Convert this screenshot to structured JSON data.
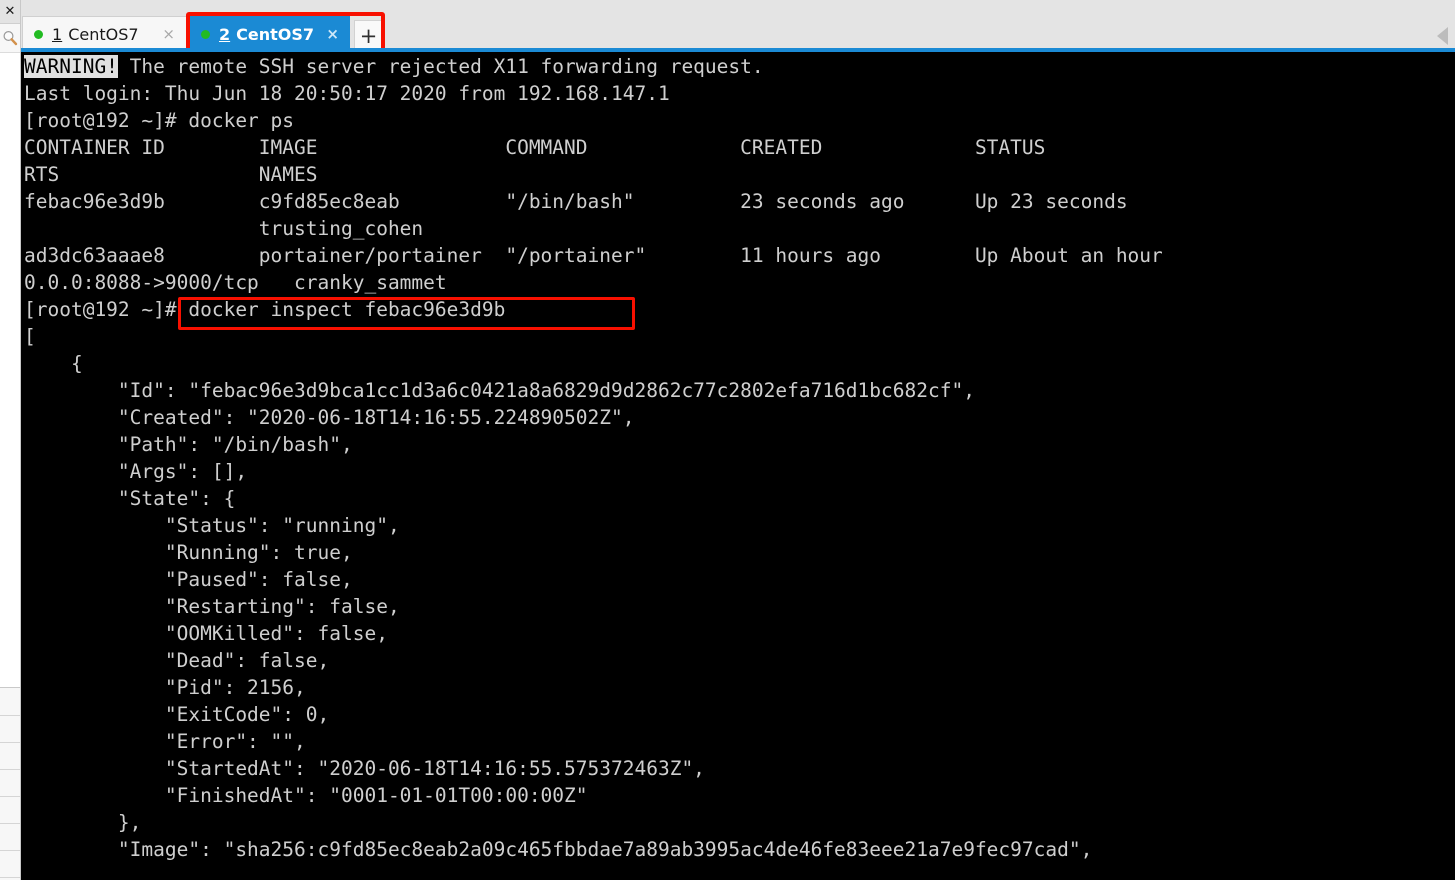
{
  "sidebar": {
    "close_icon": "close-icon",
    "search_icon": "search-icon",
    "close_glyph": "✕",
    "row_count": 7
  },
  "tabbar": {
    "collapse_icon": "collapse-arrow-icon",
    "new_tab_label": "+",
    "close_glyph": "×",
    "accent_color": "#1b8ad4",
    "highlight_color": "#f81000",
    "tabs": [
      {
        "number": "1",
        "label": "CentOS7",
        "active": false,
        "status_color": "#22bb22"
      },
      {
        "number": "2",
        "label": "CentOS7",
        "active": true,
        "status_color": "#22bb22"
      }
    ]
  },
  "terminal": {
    "background": "#000000",
    "foreground": "#cfcfcf",
    "warning_badge": "WARNING!",
    "lines": [
      {
        "id": "warning",
        "inverted_prefix": "WARNING!",
        "text": " The remote SSH server rejected X11 forwarding request."
      },
      {
        "id": "last-login",
        "text": "Last login: Thu Jun 18 20:50:17 2020 from 192.168.147.1"
      },
      {
        "id": "prompt-docker-ps",
        "text": "[root@192 ~]# docker ps"
      },
      {
        "id": "ps-header-1",
        "text": "CONTAINER ID        IMAGE                COMMAND             CREATED             STATUS"
      },
      {
        "id": "ps-header-2",
        "text": "RTS                 NAMES"
      },
      {
        "id": "ps-row-1a",
        "text": "febac96e3d9b        c9fd85ec8eab         \"/bin/bash\"         23 seconds ago      Up 23 seconds"
      },
      {
        "id": "ps-row-1b",
        "text": "                    trusting_cohen"
      },
      {
        "id": "ps-row-2a",
        "text": "ad3dc63aaae8        portainer/portainer  \"/portainer\"        11 hours ago        Up About an hour"
      },
      {
        "id": "ps-row-2b",
        "text": "0.0.0:8088->9000/tcp   cranky_sammet"
      },
      {
        "id": "prompt-docker-inspect",
        "text": "[root@192 ~]# docker inspect febac96e3d9b"
      },
      {
        "id": "json-open-bracket",
        "text": "["
      },
      {
        "id": "json-open-brace",
        "text": "    {"
      },
      {
        "id": "json-id",
        "text": "        \"Id\": \"febac96e3d9bca1cc1d3a6c0421a8a6829d9d2862c77c2802efa716d1bc682cf\","
      },
      {
        "id": "json-created",
        "text": "        \"Created\": \"2020-06-18T14:16:55.224890502Z\","
      },
      {
        "id": "json-path",
        "text": "        \"Path\": \"/bin/bash\","
      },
      {
        "id": "json-args",
        "text": "        \"Args\": [],"
      },
      {
        "id": "json-state-open",
        "text": "        \"State\": {"
      },
      {
        "id": "json-status",
        "text": "            \"Status\": \"running\","
      },
      {
        "id": "json-running",
        "text": "            \"Running\": true,"
      },
      {
        "id": "json-paused",
        "text": "            \"Paused\": false,"
      },
      {
        "id": "json-restarting",
        "text": "            \"Restarting\": false,"
      },
      {
        "id": "json-oomkilled",
        "text": "            \"OOMKilled\": false,"
      },
      {
        "id": "json-dead",
        "text": "            \"Dead\": false,"
      },
      {
        "id": "json-pid",
        "text": "            \"Pid\": 2156,"
      },
      {
        "id": "json-exitcode",
        "text": "            \"ExitCode\": 0,"
      },
      {
        "id": "json-error",
        "text": "            \"Error\": \"\","
      },
      {
        "id": "json-startedat",
        "text": "            \"StartedAt\": \"2020-06-18T14:16:55.575372463Z\","
      },
      {
        "id": "json-finishedat",
        "text": "            \"FinishedAt\": \"0001-01-01T00:00:00Z\""
      },
      {
        "id": "json-state-close",
        "text": "        },"
      },
      {
        "id": "json-image",
        "text": "        \"Image\": \"sha256:c9fd85ec8eab2a09c465fbbdae7a89ab3995ac4de46fe83eee21a7e9fec97cad\","
      }
    ],
    "highlighted_command": "]# docker inspect febac96e3d9b"
  }
}
